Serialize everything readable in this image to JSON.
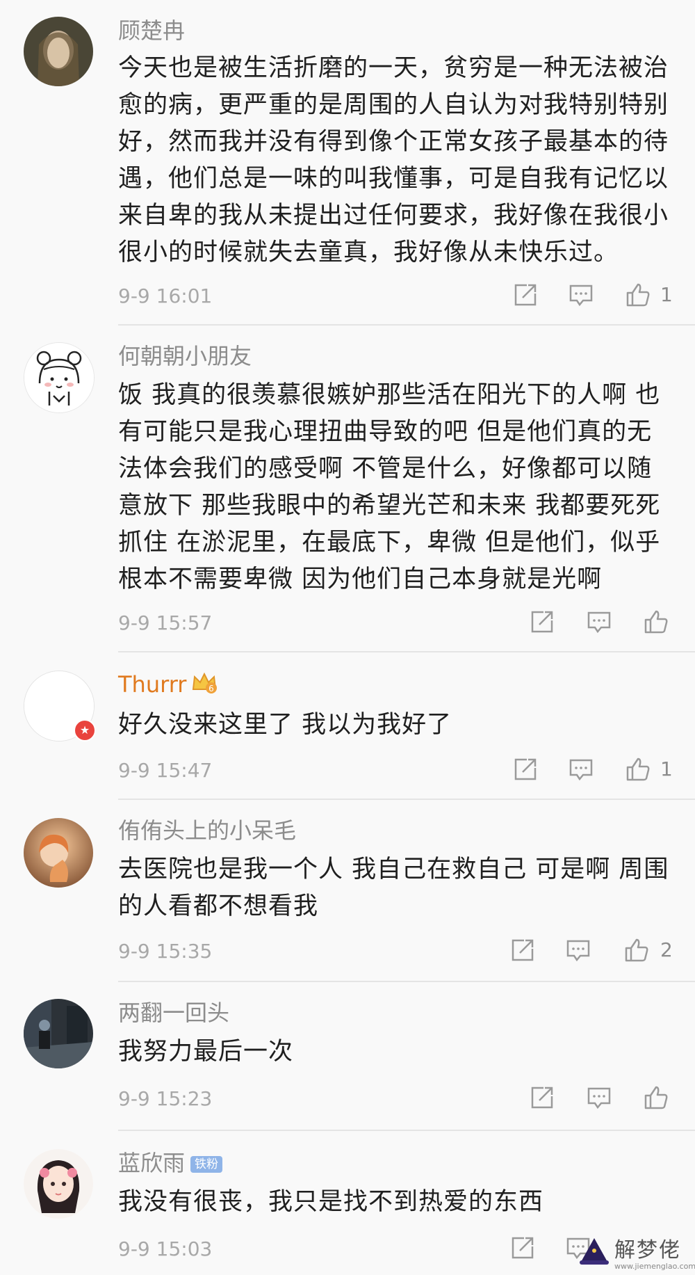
{
  "comments": [
    {
      "name": "顾楚冉",
      "lines": [
        "今天也是被生活折磨的一天，贫穷是一种无法被治",
        "愈的病，更严重的是周围的人自认为对我特别特别",
        "好，然而我并没有得到像个正常女孩子最基本的待",
        "遇，他们总是一味的叫我懂事，可是自我有记忆以",
        "来自卑的我从未提出过任何要求，我好像在我很小",
        "很小的时候就失去童真，我好像从未快乐过。"
      ],
      "time": "9-9 16:01",
      "likes": "1"
    },
    {
      "name": "何朝朝小朋友",
      "lines": [
        "饭 我真的很羡慕很嫉妒那些活在阳光下的人啊 也",
        "有可能只是我心理扭曲导致的吧 但是他们真的无",
        "法体会我们的感受啊 不管是什么，好像都可以随",
        "意放下 那些我眼中的希望光芒和未来 我都要死死",
        "抓住 在淤泥里，在最底下，卑微 但是他们，似乎",
        "根本不需要卑微 因为他们自己本身就是光啊"
      ],
      "time": "9-9 15:57",
      "likes": ""
    },
    {
      "name": "Thurrr",
      "lines": [
        "好久没来这里了 我以为我好了"
      ],
      "time": "9-9 15:47",
      "likes": "1"
    },
    {
      "name": "侑侑头上的小呆毛",
      "lines": [
        "去医院也是我一个人 我自己在救自己 可是啊 周围",
        "的人看都不想看我"
      ],
      "time": "9-9 15:35",
      "likes": "2"
    },
    {
      "name": "两翻一回头",
      "lines": [
        "我努力最后一次"
      ],
      "time": "9-9 15:23",
      "likes": ""
    },
    {
      "name": "蓝欣雨",
      "tag": "铁粉",
      "lines": [
        "我没有很丧，我只是找不到热爱的东西"
      ],
      "time": "9-9 15:03",
      "likes": ""
    }
  ],
  "badge_level": "6",
  "watermark": {
    "text": "解梦佬",
    "url": "www.jiemenglao.com"
  },
  "colors": {
    "vip_name": "#e07a1f",
    "name": "#8c8c8c",
    "body": "#1f1f1f",
    "meta": "#a8a8a8"
  }
}
